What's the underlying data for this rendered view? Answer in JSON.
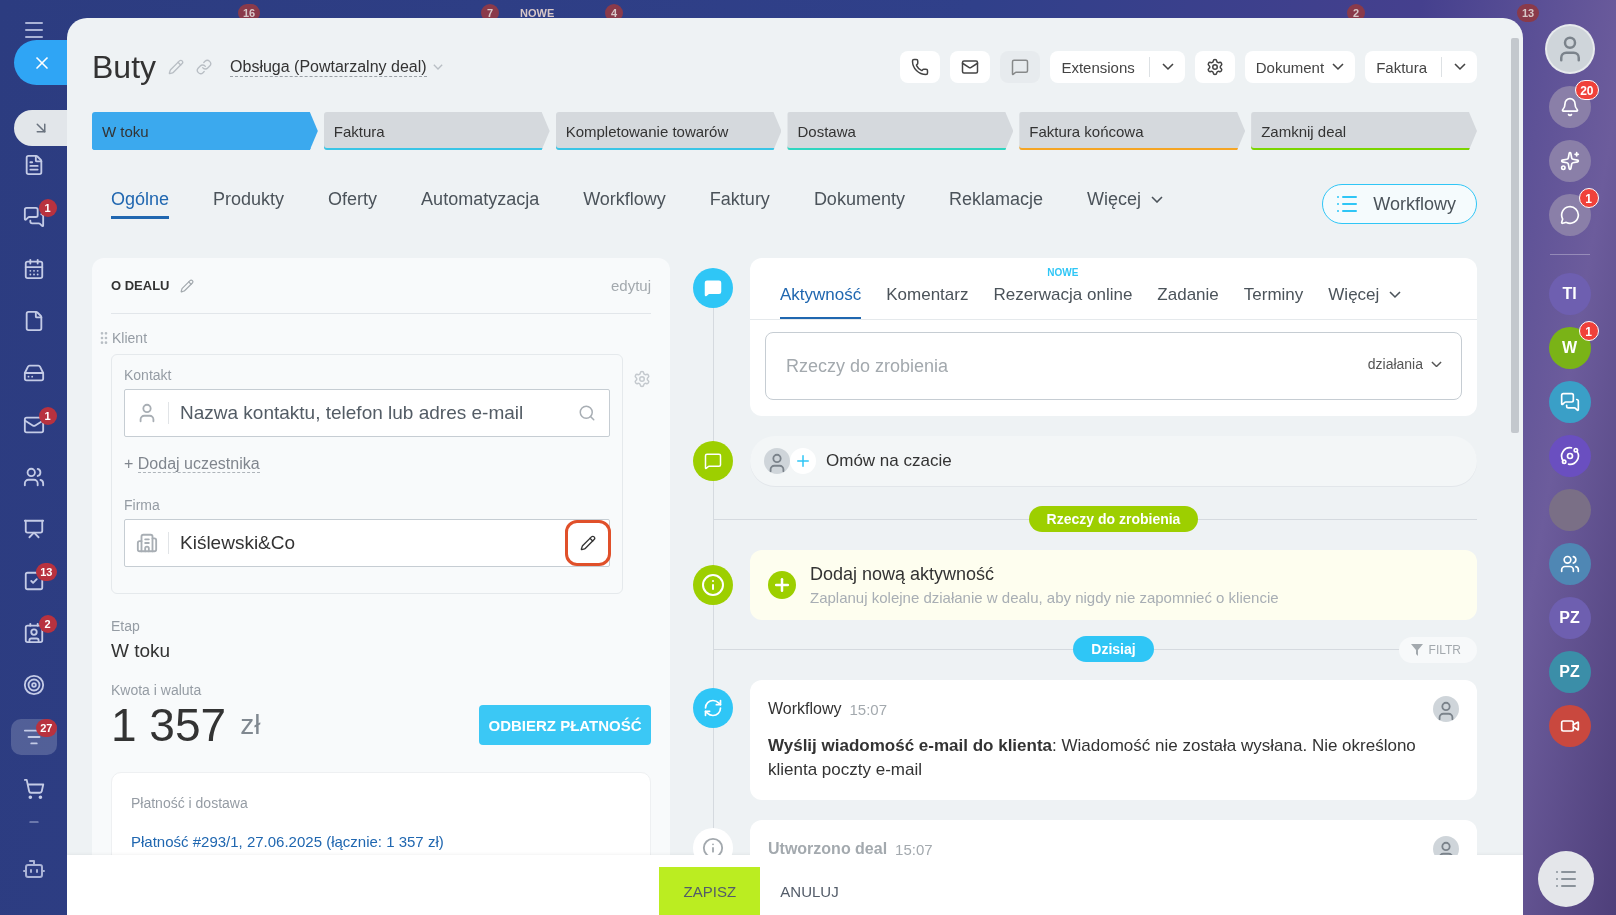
{
  "background_badges": [
    {
      "text": "16"
    },
    {
      "text": "7"
    },
    {
      "text": "NOWE"
    },
    {
      "text": "4"
    },
    {
      "text": "2"
    },
    {
      "text": "13"
    }
  ],
  "left_rail": [
    {
      "selected": false
    },
    {
      "badge": "1",
      "selected": false
    },
    {
      "selected": false
    },
    {
      "selected": false
    },
    {
      "selected": false
    },
    {
      "badge": "1",
      "selected": false
    },
    {
      "selected": false
    },
    {
      "selected": false
    },
    {
      "badge": "13",
      "selected": false
    },
    {
      "badge": "2",
      "selected": false
    },
    {
      "selected": false
    },
    {
      "badge": "27",
      "selected": true
    },
    {
      "selected": false
    }
  ],
  "header": {
    "title": "Buty",
    "category": "Obsługa (Powtarzalny deal)"
  },
  "toolbar": [
    {
      "kind": "icon",
      "disabled": false
    },
    {
      "kind": "icon",
      "disabled": false
    },
    {
      "kind": "icon",
      "disabled": true
    },
    {
      "kind": "split",
      "label": "Extensions"
    },
    {
      "kind": "icon",
      "disabled": false
    },
    {
      "kind": "dropdown",
      "label": "Dokument"
    },
    {
      "kind": "split",
      "label": "Faktura"
    }
  ],
  "stages": [
    {
      "label": "W toku",
      "selected": true,
      "color": "#3ba9ee"
    },
    {
      "label": "Faktura",
      "selected": false,
      "color": "#39c5e6"
    },
    {
      "label": "Kompletowanie towarów",
      "selected": false,
      "color": "#39c5e6"
    },
    {
      "label": "Dostawa",
      "selected": false,
      "color": "#2fd6c0"
    },
    {
      "label": "Faktura końcowa",
      "selected": false,
      "color": "#f5a524"
    },
    {
      "label": "Zamknij deal",
      "selected": false,
      "color": "#7bd500"
    }
  ],
  "tabs": [
    {
      "label": "Ogólne",
      "selected": true,
      "kind": "tab"
    },
    {
      "label": "Produkty",
      "selected": false,
      "kind": "tab"
    },
    {
      "label": "Oferty",
      "selected": false,
      "kind": "tab"
    },
    {
      "label": "Automatyzacja",
      "selected": false,
      "kind": "tab"
    },
    {
      "label": "Workflowy",
      "selected": false,
      "kind": "tab"
    },
    {
      "label": "Faktury",
      "selected": false,
      "kind": "tab"
    },
    {
      "label": "Dokumenty",
      "selected": false,
      "kind": "tab"
    },
    {
      "label": "Reklamacje",
      "selected": false,
      "kind": "tab"
    },
    {
      "label": "Więcej",
      "selected": false,
      "kind": "menu"
    }
  ],
  "workflow_button": "Workflowy",
  "deal_card": {
    "title": "O DEALU",
    "edit": "edytuj",
    "section": "Klient",
    "contact_label": "Kontakt",
    "contact_placeholder": "Nazwa kontaktu, telefon lub adres e-mail",
    "add_prefix": "+",
    "add_label": "Dodaj uczestnika",
    "company_label": "Firma",
    "company_value": "Kiślewski&Co",
    "company_edit_highlighted": true,
    "stage_label": "Etap",
    "stage_value": "W toku",
    "amount_label": "Kwota i waluta",
    "amount": "1 357",
    "currency": "zł",
    "pay_button": "ODBIERZ PŁATNOŚĆ",
    "payment_title": "Płatność i dostawa",
    "payment_link": "Płatność #293/1, 27.06.2025 (łącznie: 1 357 zł)"
  },
  "timeline": [
    {
      "kind": "composer",
      "tabs": [
        {
          "label": "Aktywność",
          "selected": true,
          "kind": "tab"
        },
        {
          "label": "Komentarz",
          "selected": false,
          "kind": "tab"
        },
        {
          "label": "Rezerwacja online",
          "selected": false,
          "kind": "tab",
          "badge": "NOWE"
        },
        {
          "label": "Zadanie",
          "selected": false,
          "kind": "tab"
        },
        {
          "label": "Terminy",
          "selected": false,
          "kind": "tab"
        },
        {
          "label": "Więcej",
          "selected": false,
          "kind": "menu"
        }
      ],
      "placeholder": "Rzeczy do zrobienia",
      "action": "działania"
    },
    {
      "kind": "chat",
      "label": "Omów na czacie"
    },
    {
      "kind": "divider",
      "label": "Rzeczy do zrobienia",
      "color": "#9dcf00"
    },
    {
      "kind": "add",
      "title": "Dodaj nową aktywność",
      "subtitle": "Zaplanuj kolejne działanie w dealu, aby nigdy nie zapomnieć o kliencie"
    },
    {
      "kind": "divider",
      "label": "Dzisiaj",
      "color": "#2fc6f6",
      "filter": "FILTR"
    },
    {
      "kind": "entry",
      "title": "Workflowy",
      "time": "15:07",
      "text": "**Wyślij wiadomość e-mail do klienta**: Wiadomość nie została wysłana. Nie określono klienta poczty e-mail",
      "muted": false
    },
    {
      "kind": "entry",
      "title": "Utworzono deal",
      "time": "15:07",
      "muted": true
    }
  ],
  "footer": {
    "save": "ZAPISZ",
    "cancel": "ANULUJ"
  },
  "right_rail": [
    {
      "kind": "avatar"
    },
    {
      "kind": "icon",
      "badge": "20",
      "color": "#8a7fa8"
    },
    {
      "kind": "icon",
      "color": "#8a7fa8"
    },
    {
      "kind": "icon",
      "badge": "1",
      "color": "#8a7fa8"
    },
    {
      "kind": "separator"
    },
    {
      "kind": "initials",
      "text": "TI",
      "color": "#6e5fb0"
    },
    {
      "kind": "initials",
      "text": "W",
      "badge": "1",
      "color": "#7ab317"
    },
    {
      "kind": "icon",
      "color": "#3a9fc7"
    },
    {
      "kind": "icon",
      "color": "#6a4fc0"
    },
    {
      "kind": "photo"
    },
    {
      "kind": "icon",
      "color": "#4f87b4"
    },
    {
      "kind": "initials",
      "text": "PZ",
      "color": "#6e5fb0"
    },
    {
      "kind": "initials",
      "text": "PZ",
      "color": "#3b8ea8"
    },
    {
      "kind": "icon",
      "color": "#c9483e"
    }
  ]
}
